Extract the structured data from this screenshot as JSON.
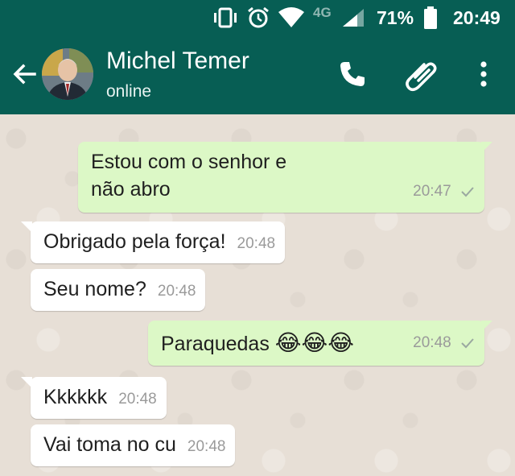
{
  "status_bar": {
    "network": "4G",
    "battery": "71%",
    "time": "20:49"
  },
  "header": {
    "contact_name": "Michel Temer",
    "contact_status": "online"
  },
  "messages": [
    {
      "direction": "out",
      "lines": [
        "Estou com o senhor e",
        "não abro"
      ],
      "time": "20:47",
      "status": "sent"
    },
    {
      "direction": "in",
      "text": "Obrigado pela força!",
      "time": "20:48"
    },
    {
      "direction": "in",
      "text": "Seu nome?",
      "time": "20:48"
    },
    {
      "direction": "out",
      "text": "Paraquedas",
      "emoji": "😂😂😂",
      "time": "20:48",
      "status": "sent"
    },
    {
      "direction": "in",
      "text": "Kkkkkk",
      "time": "20:48"
    },
    {
      "direction": "in",
      "text": "Vai toma no cu",
      "time": "20:48"
    }
  ],
  "colors": {
    "header": "#075e54",
    "outgoing_bubble": "#dcf8c6",
    "incoming_bubble": "#ffffff",
    "chat_background": "#e5ddd5"
  },
  "icons": [
    "vibrate-icon",
    "alarm-icon",
    "wifi-icon",
    "signal-icon",
    "battery-icon",
    "back-arrow-icon",
    "phone-icon",
    "attach-icon",
    "more-options-icon"
  ]
}
